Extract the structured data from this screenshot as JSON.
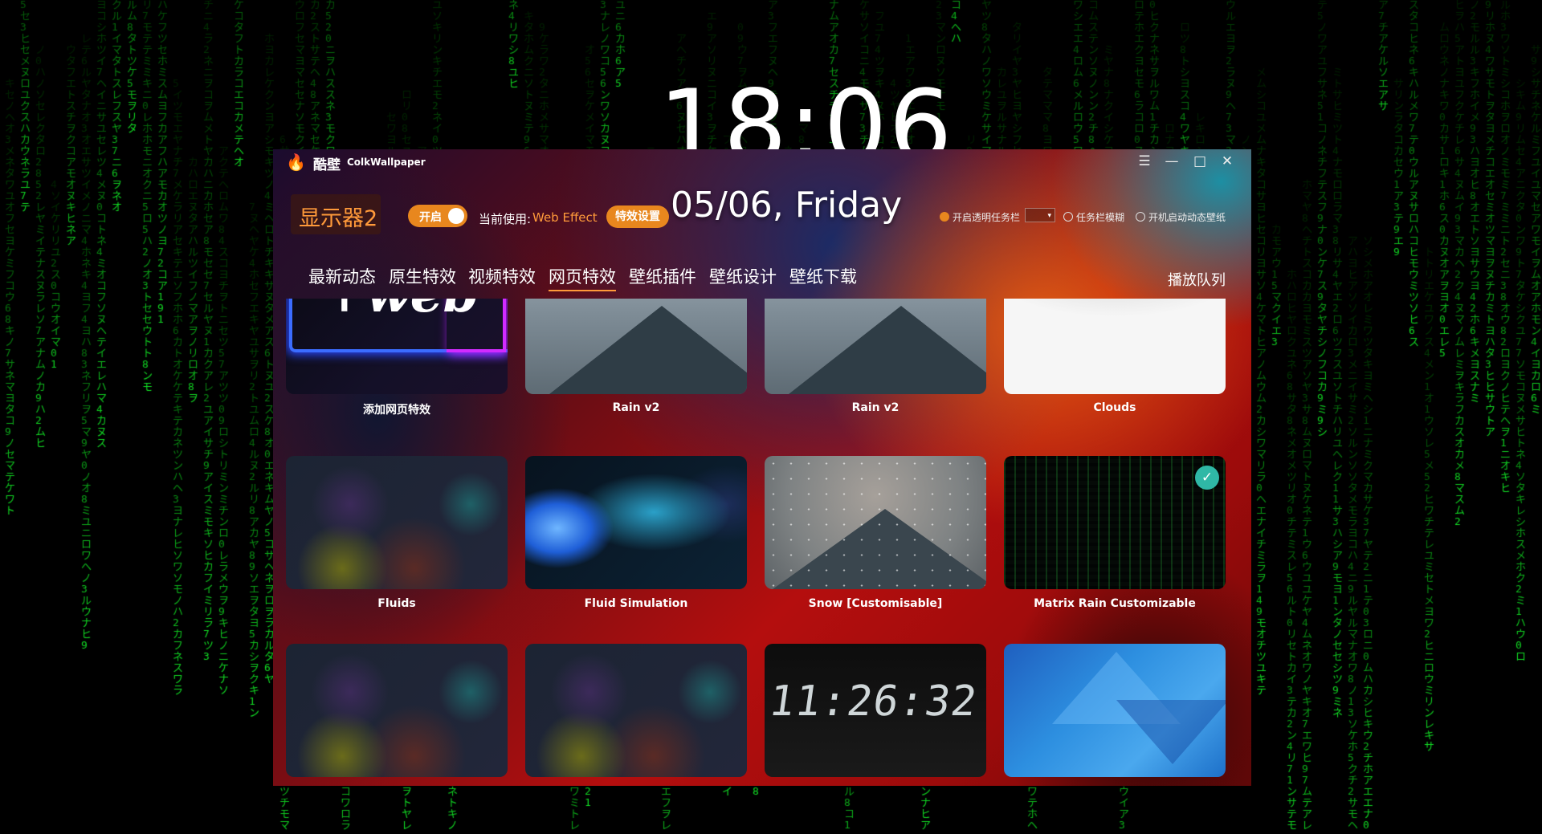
{
  "desktop": {
    "clock": "18:06",
    "date": "05/06, Friday"
  },
  "app": {
    "title_cn": "酷壁",
    "title_en": "ColkWallpaper",
    "window_controls": {
      "menu_icon": "menu-icon",
      "minimize_icon": "minimize-icon",
      "maximize_icon": "maximize-icon",
      "close_icon": "close-icon"
    },
    "monitor_label": "显示器2",
    "toggle_label": "开启",
    "current_use_label": "当前使用:",
    "current_use_value": "Web Effect",
    "fx_settings_button": "特效设置",
    "options": {
      "transparent_taskbar": "开启透明任务栏",
      "taskbar_blur": "任务栏模糊",
      "startup_dynamic": "开机启动动态壁纸"
    },
    "tabs": [
      {
        "label": "最新动态"
      },
      {
        "label": "原生特效"
      },
      {
        "label": "视频特效"
      },
      {
        "label": "网页特效"
      },
      {
        "label": "壁纸插件"
      },
      {
        "label": "壁纸设计"
      },
      {
        "label": "壁纸下载"
      }
    ],
    "active_tab": "网页特效",
    "queue_button": "播放队列",
    "cards": [
      {
        "label": "添加网页特效",
        "thumb_text": "+web"
      },
      {
        "label": "Rain v2"
      },
      {
        "label": "Rain v2"
      },
      {
        "label": "Clouds"
      },
      {
        "label": "Fluids"
      },
      {
        "label": "Fluid Simulation"
      },
      {
        "label": "Snow [Customisable]"
      },
      {
        "label": "Matrix Rain Customizable",
        "selected": true
      },
      {
        "label": ""
      },
      {
        "label": ""
      },
      {
        "label": "",
        "thumb_text": "11:26:32"
      },
      {
        "label": ""
      }
    ]
  },
  "colors": {
    "accent": "#e8871e",
    "accent_text": "#ff9a3a",
    "matrix_green": "#1fd13a",
    "check_teal": "#2fb8a6"
  }
}
